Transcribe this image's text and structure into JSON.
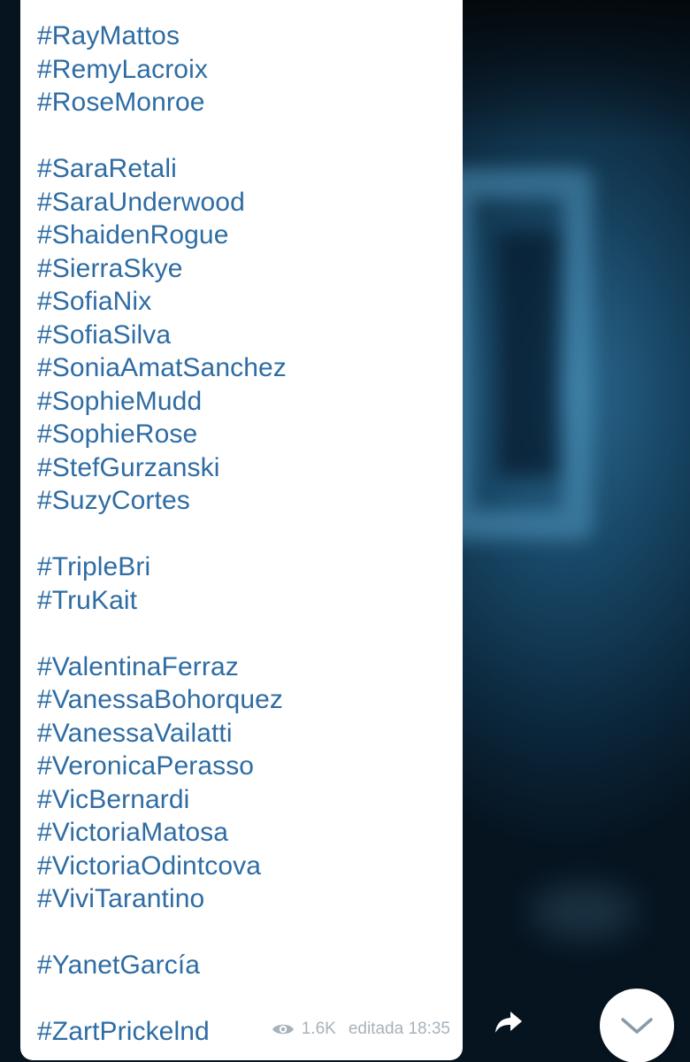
{
  "message": {
    "hashtags": [
      "#RayMattos",
      "#RemyLacroix",
      "#RoseMonroe",
      "",
      "#SaraRetali",
      "#SaraUnderwood",
      "#ShaidenRogue",
      "#SierraSkye",
      "#SofiaNix",
      "#SofiaSilva",
      "#SoniaAmatSanchez",
      "#SophieMudd",
      "#SophieRose",
      "#StefGurzanski",
      "#SuzyCortes",
      "",
      "#TripleBri",
      "#TruKait",
      "",
      "#ValentinaFerraz",
      "#VanessaBohorquez",
      "#VanessaVailatti",
      "#VeronicaPerasso",
      "#VicBernardi",
      "#VictoriaMatosa",
      "#VictoriaOdintcova",
      "#ViviTarantino",
      "",
      "#YanetGarcía",
      "",
      "#ZartPrickelnd"
    ],
    "views": "1.6K",
    "edited_label": "editada 18:35"
  },
  "icons": {
    "views": "eye-icon",
    "share": "share-arrow-icon",
    "scroll_down": "chevron-down-icon"
  },
  "colors": {
    "hashtag": "#2e6ca3",
    "meta_text": "#a8b2bb",
    "bubble": "#ffffff"
  }
}
